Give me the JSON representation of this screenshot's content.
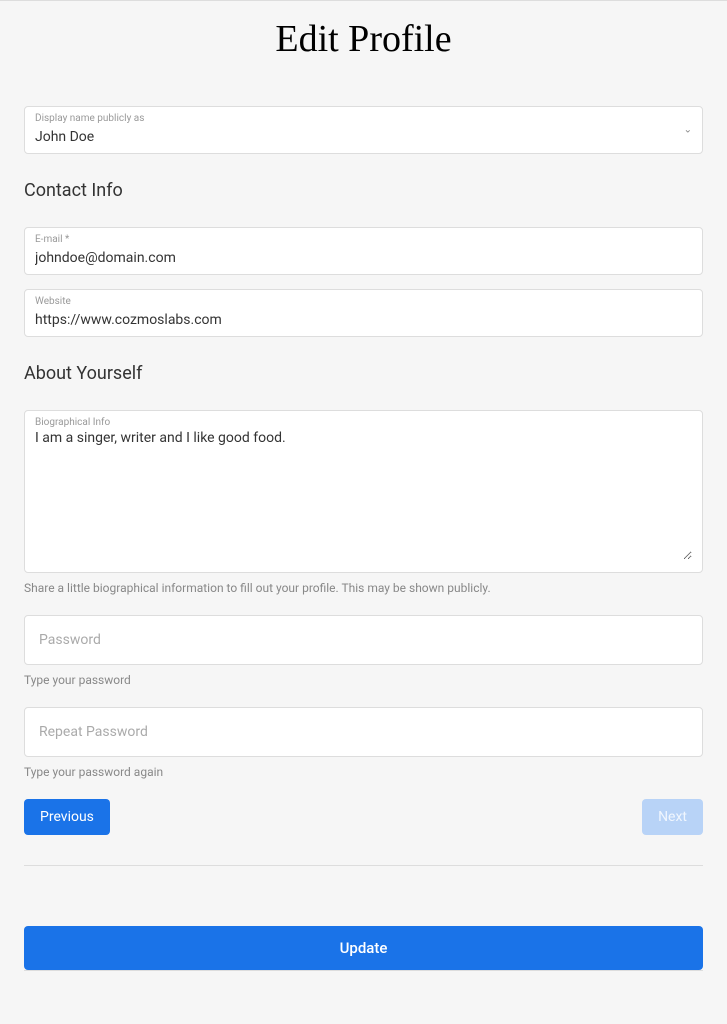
{
  "title": "Edit Profile",
  "displayName": {
    "label": "Display name publicly as",
    "value": "John Doe"
  },
  "sections": {
    "contactHeading": "Contact Info",
    "aboutHeading": "About Yourself"
  },
  "email": {
    "label": "E-mail *",
    "value": "johndoe@domain.com"
  },
  "website": {
    "label": "Website",
    "value": "https://www.cozmoslabs.com"
  },
  "bio": {
    "label": "Biographical Info",
    "value": "I am a singer, writer and I like good food.",
    "helper": "Share a little biographical information to fill out your profile. This may be shown publicly."
  },
  "password": {
    "placeholder": "Password",
    "helper": "Type your password"
  },
  "repeatPassword": {
    "placeholder": "Repeat Password",
    "helper": "Type your password again"
  },
  "nav": {
    "previous": "Previous",
    "next": "Next"
  },
  "submit": "Update"
}
